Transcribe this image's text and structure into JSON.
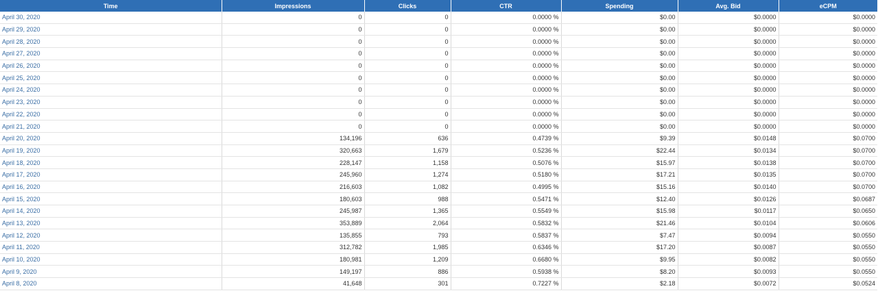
{
  "columns": [
    "Time",
    "Impressions",
    "Clicks",
    "CTR",
    "Spending",
    "Avg. Bid",
    "eCPM"
  ],
  "rows": [
    [
      "April 30, 2020",
      "0",
      "0",
      "0.0000 %",
      "$0.00",
      "$0.0000",
      "$0.0000"
    ],
    [
      "April 29, 2020",
      "0",
      "0",
      "0.0000 %",
      "$0.00",
      "$0.0000",
      "$0.0000"
    ],
    [
      "April 28, 2020",
      "0",
      "0",
      "0.0000 %",
      "$0.00",
      "$0.0000",
      "$0.0000"
    ],
    [
      "April 27, 2020",
      "0",
      "0",
      "0.0000 %",
      "$0.00",
      "$0.0000",
      "$0.0000"
    ],
    [
      "April 26, 2020",
      "0",
      "0",
      "0.0000 %",
      "$0.00",
      "$0.0000",
      "$0.0000"
    ],
    [
      "April 25, 2020",
      "0",
      "0",
      "0.0000 %",
      "$0.00",
      "$0.0000",
      "$0.0000"
    ],
    [
      "April 24, 2020",
      "0",
      "0",
      "0.0000 %",
      "$0.00",
      "$0.0000",
      "$0.0000"
    ],
    [
      "April 23, 2020",
      "0",
      "0",
      "0.0000 %",
      "$0.00",
      "$0.0000",
      "$0.0000"
    ],
    [
      "April 22, 2020",
      "0",
      "0",
      "0.0000 %",
      "$0.00",
      "$0.0000",
      "$0.0000"
    ],
    [
      "April 21, 2020",
      "0",
      "0",
      "0.0000 %",
      "$0.00",
      "$0.0000",
      "$0.0000"
    ],
    [
      "April 20, 2020",
      "134,196",
      "636",
      "0.4739 %",
      "$9.39",
      "$0.0148",
      "$0.0700"
    ],
    [
      "April 19, 2020",
      "320,663",
      "1,679",
      "0.5236 %",
      "$22.44",
      "$0.0134",
      "$0.0700"
    ],
    [
      "April 18, 2020",
      "228,147",
      "1,158",
      "0.5076 %",
      "$15.97",
      "$0.0138",
      "$0.0700"
    ],
    [
      "April 17, 2020",
      "245,960",
      "1,274",
      "0.5180 %",
      "$17.21",
      "$0.0135",
      "$0.0700"
    ],
    [
      "April 16, 2020",
      "216,603",
      "1,082",
      "0.4995 %",
      "$15.16",
      "$0.0140",
      "$0.0700"
    ],
    [
      "April 15, 2020",
      "180,603",
      "988",
      "0.5471 %",
      "$12.40",
      "$0.0126",
      "$0.0687"
    ],
    [
      "April 14, 2020",
      "245,987",
      "1,365",
      "0.5549 %",
      "$15.98",
      "$0.0117",
      "$0.0650"
    ],
    [
      "April 13, 2020",
      "353,889",
      "2,064",
      "0.5832 %",
      "$21.46",
      "$0.0104",
      "$0.0606"
    ],
    [
      "April 12, 2020",
      "135,855",
      "793",
      "0.5837 %",
      "$7.47",
      "$0.0094",
      "$0.0550"
    ],
    [
      "April 11, 2020",
      "312,782",
      "1,985",
      "0.6346 %",
      "$17.20",
      "$0.0087",
      "$0.0550"
    ],
    [
      "April 10, 2020",
      "180,981",
      "1,209",
      "0.6680 %",
      "$9.95",
      "$0.0082",
      "$0.0550"
    ],
    [
      "April 9, 2020",
      "149,197",
      "886",
      "0.5938 %",
      "$8.20",
      "$0.0093",
      "$0.0550"
    ],
    [
      "April 8, 2020",
      "41,648",
      "301",
      "0.7227 %",
      "$2.18",
      "$0.0072",
      "$0.0524"
    ]
  ],
  "colors": {
    "header_bg": "#2f6fb5",
    "header_text": "#ffffff",
    "link_text": "#3a6ea5",
    "cell_text": "#333333",
    "grid_line": "#d9d9d9"
  }
}
